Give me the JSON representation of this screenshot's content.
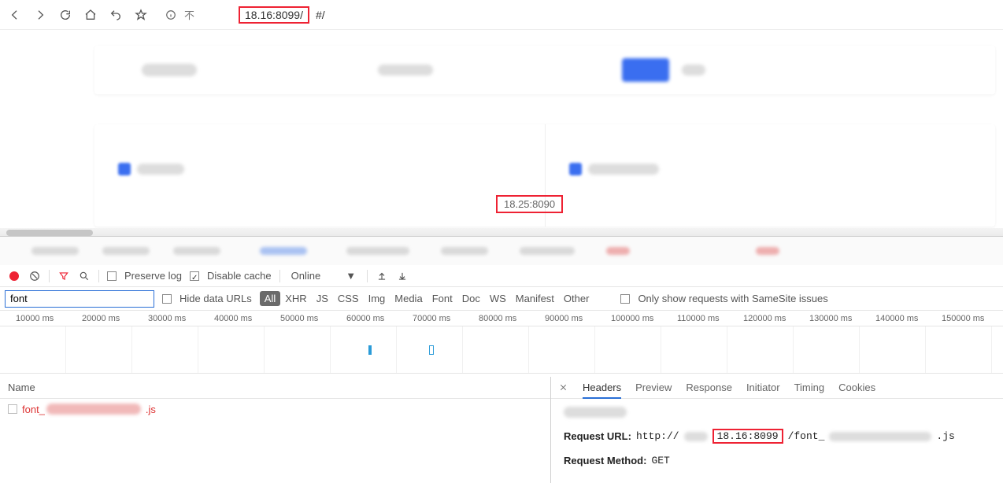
{
  "browser": {
    "secure_label": "不",
    "url_highlight": "18.16:8099/",
    "url_rest": "#/"
  },
  "page": {
    "callout_secondary": "18.25:8090"
  },
  "devtools": {
    "toolbar": {
      "preserve_log": "Preserve log",
      "disable_cache": "Disable cache",
      "online": "Online"
    },
    "filter": {
      "input_value": "font",
      "hide_data_urls": "Hide data URLs",
      "types": [
        "All",
        "XHR",
        "JS",
        "CSS",
        "Img",
        "Media",
        "Font",
        "Doc",
        "WS",
        "Manifest",
        "Other"
      ],
      "samesite": "Only show requests with SameSite issues"
    },
    "timeline_ticks": [
      "10000 ms",
      "20000 ms",
      "30000 ms",
      "40000 ms",
      "50000 ms",
      "60000 ms",
      "70000 ms",
      "80000 ms",
      "90000 ms",
      "100000 ms",
      "110000 ms",
      "120000 ms",
      "130000 ms",
      "140000 ms",
      "150000 ms"
    ],
    "left": {
      "header_name": "Name",
      "row_prefix": "font_",
      "row_suffix": ".js"
    },
    "right": {
      "tabs": [
        "Headers",
        "Preview",
        "Response",
        "Initiator",
        "Timing",
        "Cookies"
      ],
      "req_url_label": "Request URL:",
      "req_url_prefix": "http://",
      "req_url_highlight": "18.16:8099",
      "req_url_mid": "/font_",
      "req_url_suffix": ".js",
      "req_method_label": "Request Method:",
      "req_method_value": "GET"
    }
  }
}
